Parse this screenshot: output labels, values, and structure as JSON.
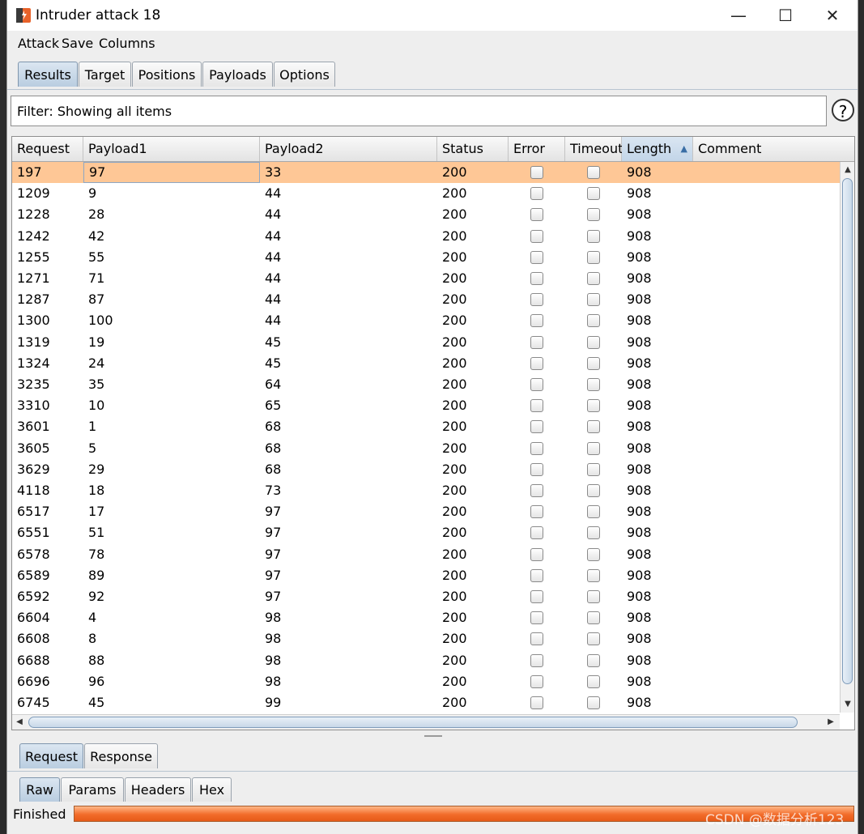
{
  "window": {
    "title": "Intruder attack 18"
  },
  "window_controls": {
    "minimize": "—",
    "maximize": "☐",
    "close": "✕"
  },
  "menu": [
    "Attack",
    "Save",
    "Columns"
  ],
  "tabs": [
    "Results",
    "Target",
    "Positions",
    "Payloads",
    "Options"
  ],
  "filter": {
    "text": "Filter: Showing all items",
    "help": "?"
  },
  "table": {
    "columns": [
      "Request",
      "Payload1",
      "Payload2",
      "Status",
      "Error",
      "Timeout",
      "Length",
      "Comment"
    ],
    "sorted_column": "Length",
    "sort_indicator": "▲",
    "rows": [
      {
        "request": "197",
        "payload1": "97",
        "payload2": "33",
        "status": "200",
        "length": "908",
        "selected": true
      },
      {
        "request": "1209",
        "payload1": "9",
        "payload2": "44",
        "status": "200",
        "length": "908"
      },
      {
        "request": "1228",
        "payload1": "28",
        "payload2": "44",
        "status": "200",
        "length": "908"
      },
      {
        "request": "1242",
        "payload1": "42",
        "payload2": "44",
        "status": "200",
        "length": "908"
      },
      {
        "request": "1255",
        "payload1": "55",
        "payload2": "44",
        "status": "200",
        "length": "908"
      },
      {
        "request": "1271",
        "payload1": "71",
        "payload2": "44",
        "status": "200",
        "length": "908"
      },
      {
        "request": "1287",
        "payload1": "87",
        "payload2": "44",
        "status": "200",
        "length": "908"
      },
      {
        "request": "1300",
        "payload1": "100",
        "payload2": "44",
        "status": "200",
        "length": "908"
      },
      {
        "request": "1319",
        "payload1": "19",
        "payload2": "45",
        "status": "200",
        "length": "908"
      },
      {
        "request": "1324",
        "payload1": "24",
        "payload2": "45",
        "status": "200",
        "length": "908"
      },
      {
        "request": "3235",
        "payload1": "35",
        "payload2": "64",
        "status": "200",
        "length": "908"
      },
      {
        "request": "3310",
        "payload1": "10",
        "payload2": "65",
        "status": "200",
        "length": "908"
      },
      {
        "request": "3601",
        "payload1": "1",
        "payload2": "68",
        "status": "200",
        "length": "908"
      },
      {
        "request": "3605",
        "payload1": "5",
        "payload2": "68",
        "status": "200",
        "length": "908"
      },
      {
        "request": "3629",
        "payload1": "29",
        "payload2": "68",
        "status": "200",
        "length": "908"
      },
      {
        "request": "4118",
        "payload1": "18",
        "payload2": "73",
        "status": "200",
        "length": "908"
      },
      {
        "request": "6517",
        "payload1": "17",
        "payload2": "97",
        "status": "200",
        "length": "908"
      },
      {
        "request": "6551",
        "payload1": "51",
        "payload2": "97",
        "status": "200",
        "length": "908"
      },
      {
        "request": "6578",
        "payload1": "78",
        "payload2": "97",
        "status": "200",
        "length": "908"
      },
      {
        "request": "6589",
        "payload1": "89",
        "payload2": "97",
        "status": "200",
        "length": "908"
      },
      {
        "request": "6592",
        "payload1": "92",
        "payload2": "97",
        "status": "200",
        "length": "908"
      },
      {
        "request": "6604",
        "payload1": "4",
        "payload2": "98",
        "status": "200",
        "length": "908"
      },
      {
        "request": "6608",
        "payload1": "8",
        "payload2": "98",
        "status": "200",
        "length": "908"
      },
      {
        "request": "6688",
        "payload1": "88",
        "payload2": "98",
        "status": "200",
        "length": "908"
      },
      {
        "request": "6696",
        "payload1": "96",
        "payload2": "98",
        "status": "200",
        "length": "908"
      },
      {
        "request": "6745",
        "payload1": "45",
        "payload2": "99",
        "status": "200",
        "length": "908"
      }
    ]
  },
  "detail_tabs": [
    "Request",
    "Response"
  ],
  "view_tabs": [
    "Raw",
    "Params",
    "Headers",
    "Hex"
  ],
  "status": {
    "label": "Finished",
    "progress": 1.0
  },
  "watermark": "CSDN @数据分析123",
  "colors": {
    "selected_row": "#fec796",
    "progress": "#f26c2a",
    "tab_active": "#b9cde0"
  }
}
